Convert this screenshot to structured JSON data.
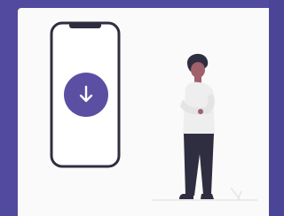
{
  "screen": {
    "illustration": "phone-download-person",
    "icons": {
      "phone": "phone-icon",
      "download": "download-arrow-icon",
      "person": "person-illustration"
    },
    "colors": {
      "background": "#524a9e",
      "card": "#fafafa",
      "accent": "#5b4fa3",
      "phone_outline": "#2f2e41",
      "skin": "#a0616a",
      "hair": "#2f2e41",
      "shirt": "#eeeeee",
      "pants": "#2f2e41"
    }
  }
}
